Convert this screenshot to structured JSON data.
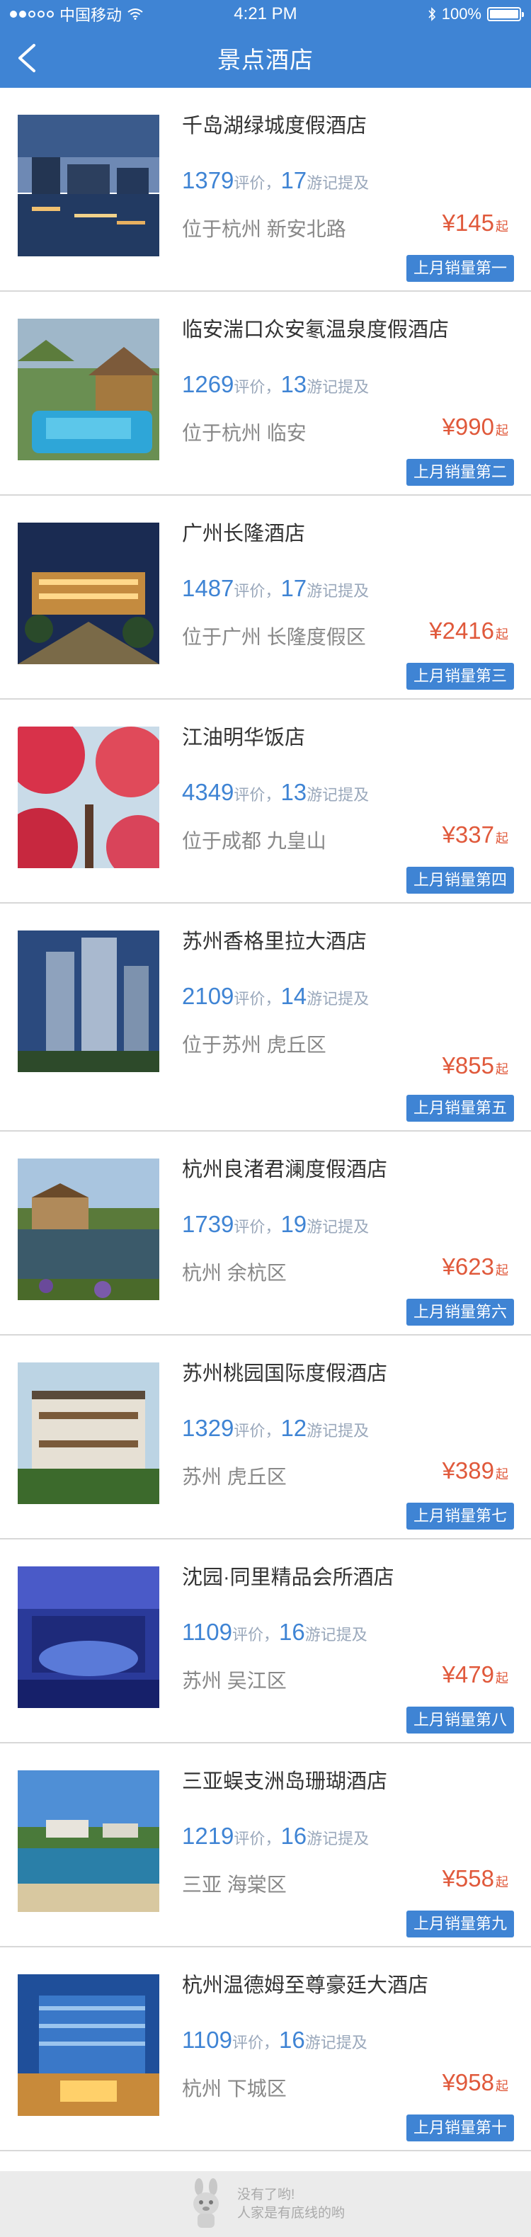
{
  "status_bar": {
    "carrier": "中国移动",
    "time": "4:21 PM",
    "battery": "100%"
  },
  "header": {
    "title": "景点酒店"
  },
  "labels": {
    "reviews_suffix": "评价",
    "sep": "，",
    "mentions_suffix": "游记提及",
    "price_suffix": "起"
  },
  "hotels": [
    {
      "name": "千岛湖绿城度假酒店",
      "reviews": "1379",
      "mentions": "17",
      "location": "位于杭州 新安北路",
      "price": "¥145",
      "badge": "上月销量第一"
    },
    {
      "name": "临安湍口众安氡温泉度假酒店",
      "reviews": "1269",
      "mentions": "13",
      "location": "位于杭州 临安",
      "price": "¥990",
      "badge": "上月销量第二"
    },
    {
      "name": "广州长隆酒店",
      "reviews": "1487",
      "mentions": "17",
      "location": "位于广州 长隆度假区",
      "price": "¥2416",
      "badge": "上月销量第三"
    },
    {
      "name": "江油明华饭店",
      "reviews": "4349",
      "mentions": "13",
      "location": "位于成都 九皇山",
      "price": "¥337",
      "badge": "上月销量第四"
    },
    {
      "name": "苏州香格里拉大酒店",
      "reviews": "2109",
      "mentions": "14",
      "location": "位于苏州 虎丘区",
      "price": "¥855",
      "badge": "上月销量第五"
    },
    {
      "name": "杭州良渚君澜度假酒店",
      "reviews": "1739",
      "mentions": "19",
      "location": "杭州 余杭区",
      "price": "¥623",
      "badge": "上月销量第六"
    },
    {
      "name": "苏州桃园国际度假酒店",
      "reviews": "1329",
      "mentions": "12",
      "location": "苏州 虎丘区",
      "price": "¥389",
      "badge": "上月销量第七"
    },
    {
      "name": "沈园·同里精品会所酒店",
      "reviews": "1109",
      "mentions": "16",
      "location": "苏州 吴江区",
      "price": "¥479",
      "badge": "上月销量第八"
    },
    {
      "name": "三亚蜈支洲岛珊瑚酒店",
      "reviews": "1219",
      "mentions": "16",
      "location": "三亚 海棠区",
      "price": "¥558",
      "badge": "上月销量第九"
    },
    {
      "name": "杭州温德姆至尊豪廷大酒店",
      "reviews": "1109",
      "mentions": "16",
      "location": "杭州 下城区",
      "price": "¥958",
      "badge": "上月销量第十"
    }
  ],
  "footer": {
    "line1": "没有了哟!",
    "line2": "人家是有底线的哟"
  },
  "colors": {
    "primary": "#3f84d4",
    "price": "#e0593b",
    "muted": "#9aa8bb"
  }
}
